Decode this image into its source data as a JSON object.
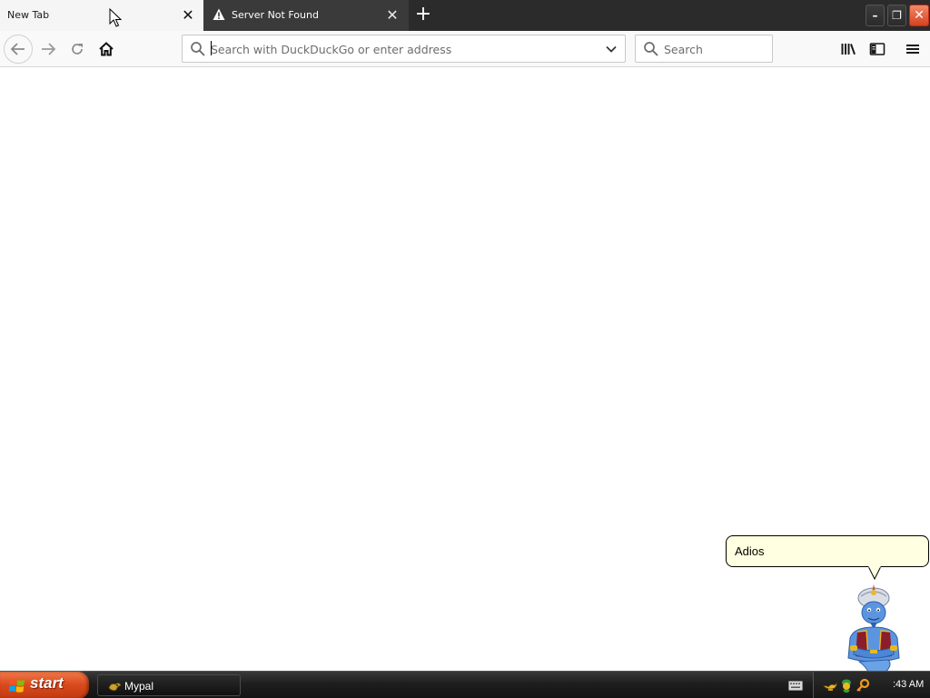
{
  "browser": {
    "tabs": [
      {
        "label": "New Tab",
        "active": true
      },
      {
        "label": "Server Not Found",
        "active": false,
        "icon": "warning-icon"
      }
    ],
    "close_glyph": "✕",
    "new_tab_glyph": "+",
    "window_buttons": {
      "minimize": "–",
      "maximize": "❐",
      "close": "✕"
    }
  },
  "toolbar": {
    "url_placeholder": "Search with DuckDuckGo or enter address",
    "url_value": "",
    "search_placeholder": "Search",
    "icons": [
      "back-arrow-icon",
      "forward-arrow-icon",
      "reload-icon",
      "home-icon",
      "library-icon",
      "sidebar-icon",
      "hamburger-menu-icon"
    ]
  },
  "assistant": {
    "balloon_text": "Adios",
    "character": "genie-agent"
  },
  "taskbar": {
    "start_label": "start",
    "task_item": "Mypal",
    "clock": ":43 AM"
  },
  "colors": {
    "tabstrip": "#2b2b2b",
    "active_tab": "#f5f5f5",
    "toolbar": "#f9f9fa",
    "start_button": "#d9481c",
    "close_button": "#d8411e",
    "balloon": "#ffffe1"
  }
}
